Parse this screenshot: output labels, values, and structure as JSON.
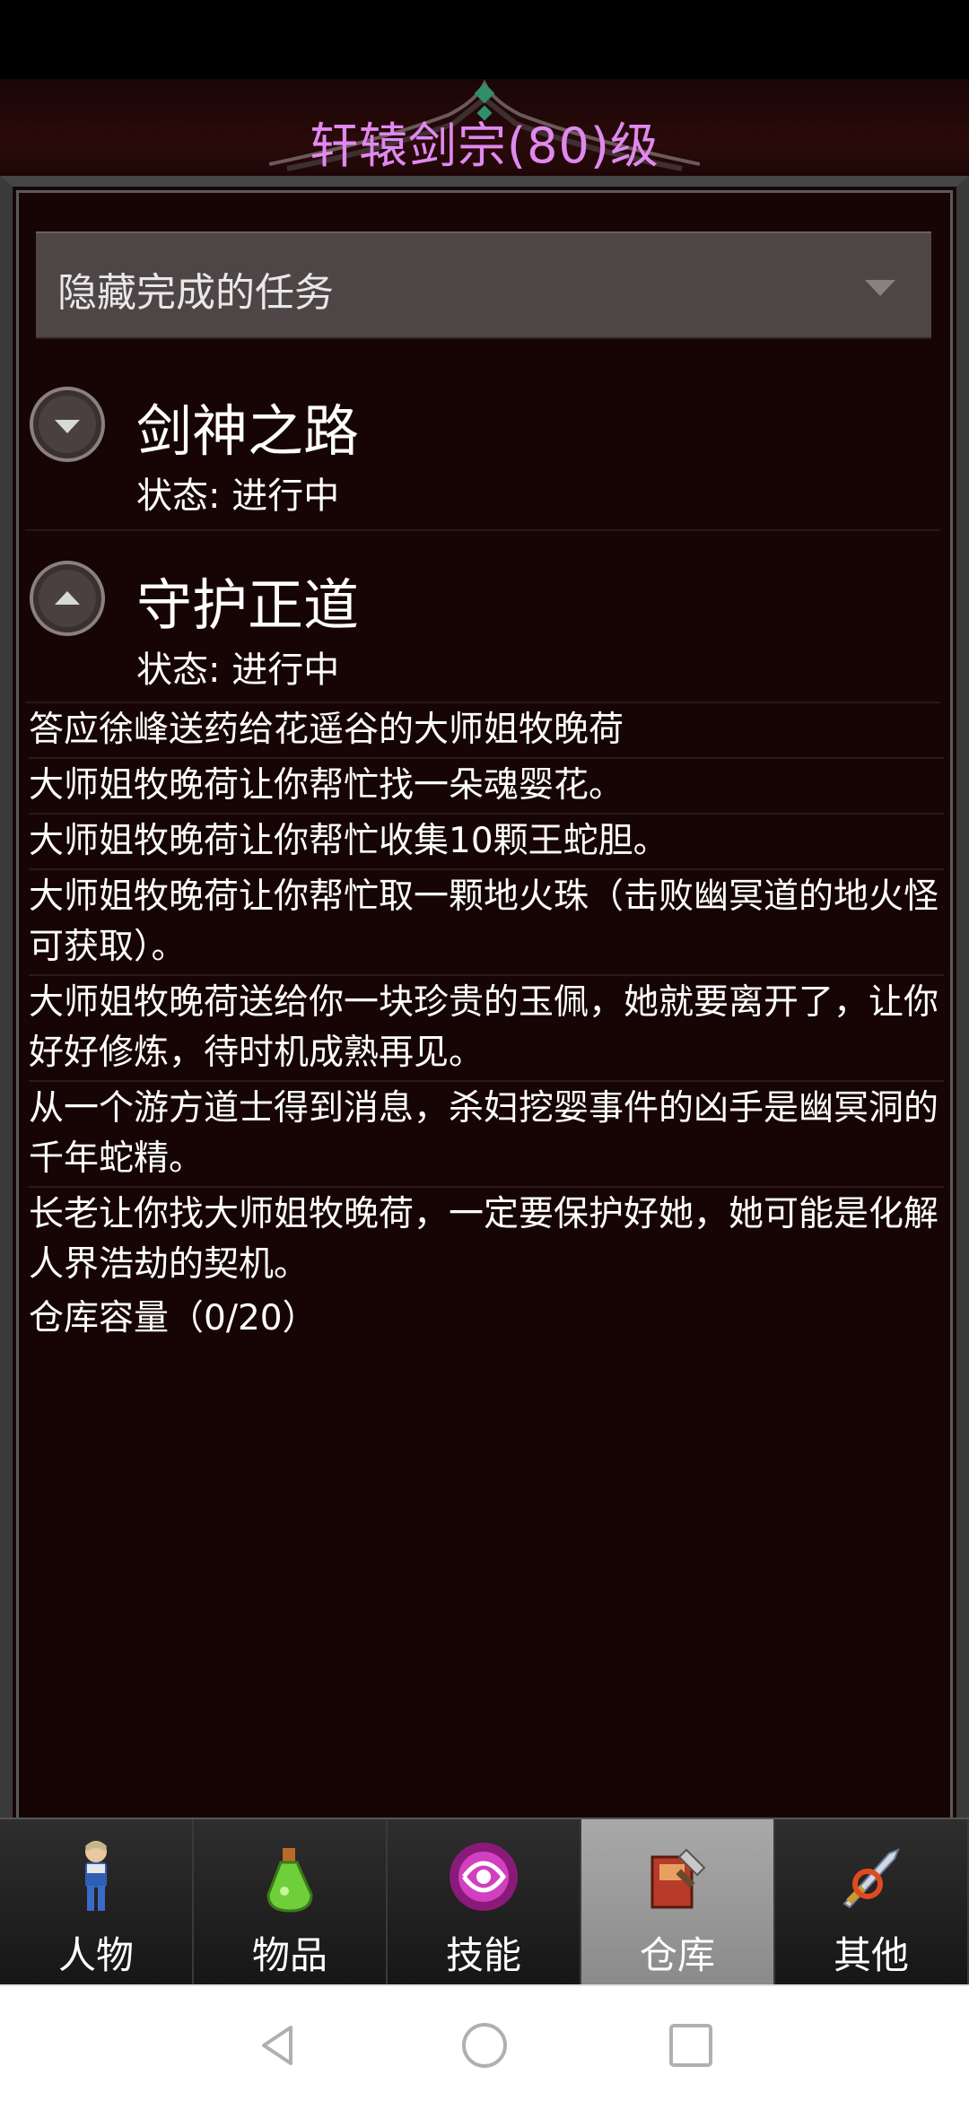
{
  "header": {
    "title": "轩辕剑宗(80)级"
  },
  "filter": {
    "selected": "隐藏完成的任务",
    "arrow_icon": "triangle-down-icon"
  },
  "quests": [
    {
      "title": "剑神之路",
      "status": "状态: 进行中",
      "toggle_icon": "chevron-down-icon"
    },
    {
      "title": "守护正道",
      "status": "状态: 进行中",
      "toggle_icon": "chevron-up-icon"
    }
  ],
  "log": [
    "答应徐峰送药给花遥谷的大师姐牧晚荷",
    "大师姐牧晚荷让你帮忙找一朵魂婴花。",
    "大师姐牧晚荷让你帮忙收集10颗王蛇胆。",
    "大师姐牧晚荷让你帮忙取一颗地火珠（击败幽冥道的地火怪可获取）。",
    "大师姐牧晚荷送给你一块珍贵的玉佩，她就要离开了，让你好好修炼，待时机成熟再见。",
    "从一个游方道士得到消息，杀妇挖婴事件的凶手是幽冥洞的千年蛇精。",
    "长老让你找大师姐牧晚荷，一定要保护好她，她可能是化解人界浩劫的契机。"
  ],
  "capacity": "仓库容量（0/20）",
  "nav": [
    {
      "label": "人物",
      "icon": "character-icon",
      "active": false
    },
    {
      "label": "物品",
      "icon": "potion-icon",
      "active": false
    },
    {
      "label": "技能",
      "icon": "skill-orb-icon",
      "active": false
    },
    {
      "label": "仓库",
      "icon": "warehouse-icon",
      "active": true
    },
    {
      "label": "其他",
      "icon": "sword-icon",
      "active": false
    }
  ],
  "colors": {
    "title": "#e089f0",
    "panel_bg": "#170506",
    "active_tab": "#a0a0a0"
  }
}
